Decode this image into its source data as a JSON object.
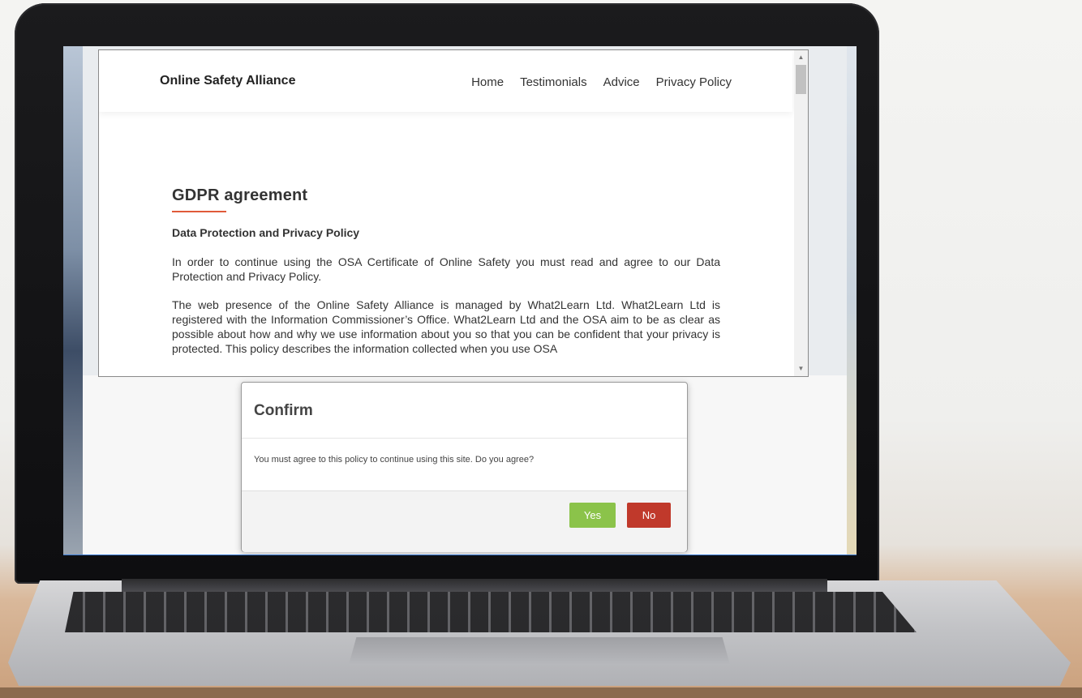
{
  "site": {
    "brand": "Online Safety Alliance",
    "nav": [
      "Home",
      "Testimonials",
      "Advice",
      "Privacy Policy"
    ]
  },
  "content": {
    "heading": "GDPR agreement",
    "subheading": "Data Protection and Privacy Policy",
    "paragraphs": [
      "In order to continue using the OSA Certificate of Online Safety you must read and agree to our Data Protection and Privacy Policy.",
      "The web presence of the Online Safety Alliance is managed by What2Learn Ltd. What2Learn Ltd is registered with the Information Commissioner’s Office. What2Learn Ltd and the OSA aim to be as clear as possible about how and why we use information about you so that you can be confident that your privacy is protected. This policy describes the information collected when you use OSA"
    ]
  },
  "modal": {
    "title": "Confirm",
    "message": "You must agree to this policy to continue using this site. Do you agree?",
    "yes_label": "Yes",
    "no_label": "No"
  },
  "colors": {
    "accent_underline": "#e05a3a",
    "yes_button": "#8bc34a",
    "no_button": "#c0392b"
  },
  "icons": {
    "scroll_up": "triangle-up-icon",
    "scroll_down": "triangle-down-icon"
  }
}
